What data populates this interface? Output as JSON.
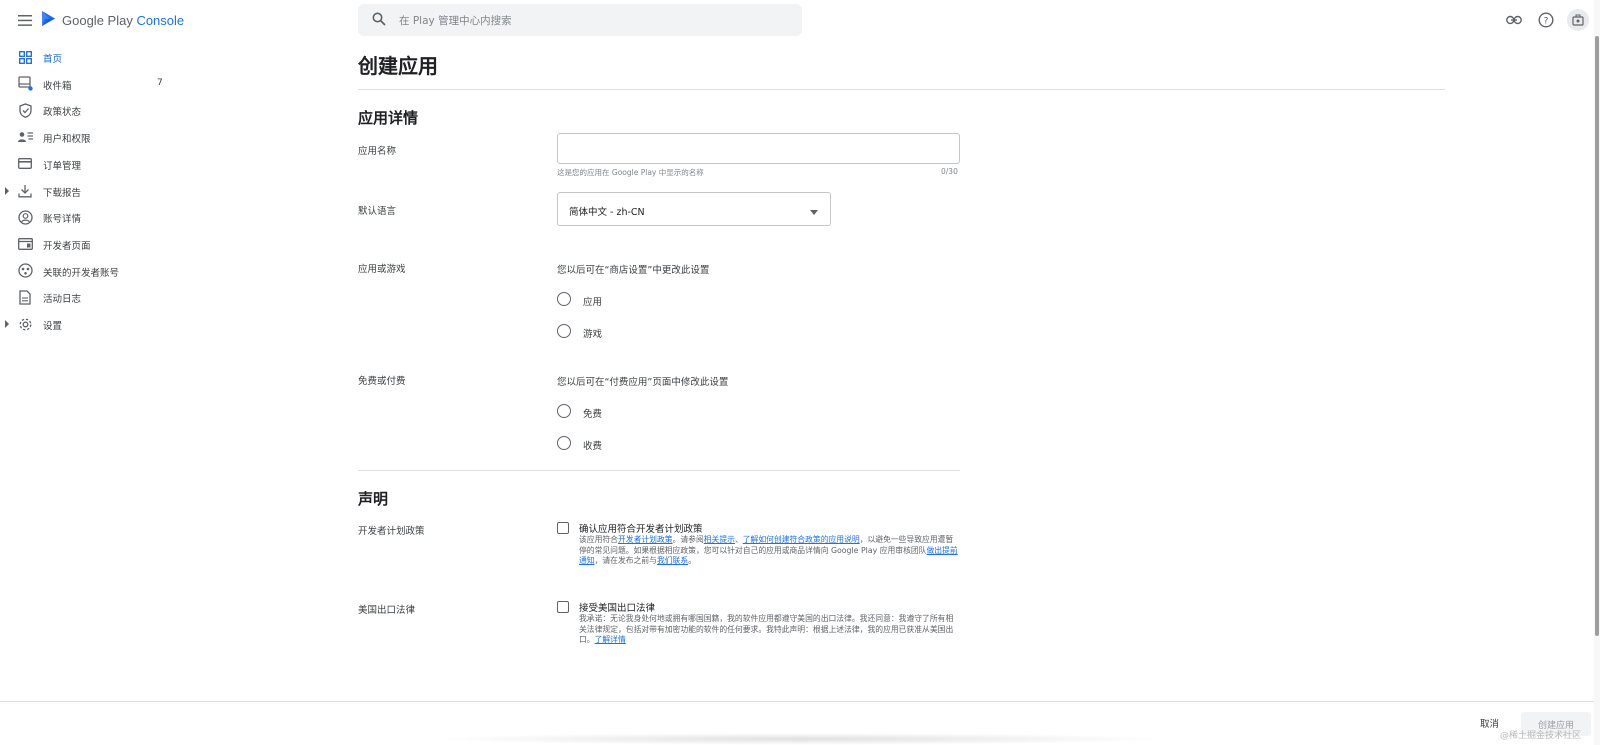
{
  "app": {
    "brand_prefix": "Google Play ",
    "brand_suffix": "Console",
    "brand_color": "#1a73e8"
  },
  "search": {
    "placeholder": "在 Play 管理中心内搜索"
  },
  "sidebar": {
    "items": [
      {
        "label": "首页",
        "icon": "dashboard-icon",
        "active": true
      },
      {
        "label": "收件箱",
        "icon": "inbox-icon",
        "count": "7"
      },
      {
        "label": "政策状态",
        "icon": "shield-icon"
      },
      {
        "label": "用户和权限",
        "icon": "users-icon"
      },
      {
        "label": "订单管理",
        "icon": "credit-card-icon"
      },
      {
        "label": "下载报告",
        "icon": "download-icon",
        "expandable": true
      },
      {
        "label": "账号详情",
        "icon": "account-icon"
      },
      {
        "label": "开发者页面",
        "icon": "web-page-icon"
      },
      {
        "label": "关联的开发者账号",
        "icon": "linked-accounts-icon"
      },
      {
        "label": "活动日志",
        "icon": "document-icon"
      },
      {
        "label": "设置",
        "icon": "gear-icon",
        "expandable": true
      }
    ]
  },
  "main": {
    "title": "创建应用",
    "details": {
      "title": "应用详情",
      "app_name": {
        "label": "应用名称",
        "value": "",
        "helper": "这是您的应用在 Google Play 中显示的名称",
        "counter": "0/30"
      },
      "language": {
        "label": "默认语言",
        "selected": "简体中文 - zh-CN"
      },
      "app_or_game": {
        "label": "应用或游戏",
        "hint": "您以后可在“商店设置”中更改此设置",
        "options": [
          "应用",
          "游戏"
        ]
      },
      "free_or_paid": {
        "label": "免费或付费",
        "hint": "您以后可在“付费应用”页面中修改此设置",
        "options": [
          "免费",
          "收费"
        ]
      }
    },
    "declarations": {
      "title": "声明",
      "policy": {
        "label": "开发者计划政策",
        "checkbox_title": "确认应用符合开发者计划政策",
        "text_1": "该应用符合",
        "link_1": "开发者计划政策",
        "text_2": "。请参阅",
        "link_2": "相关提示",
        "text_3": "、",
        "link_3": "了解如何创建符合政策的应用说明",
        "text_4": "，以避免一些导致应用遭暂停的常见问题。如果根据相应政策，您可以针对自己的应用或商品详情向 Google Play 应用审核团队",
        "link_4": "做出提前通知",
        "text_5": "，请在发布之前与",
        "link_5": "我们联系",
        "text_6": "。"
      },
      "export": {
        "label": "美国出口法律",
        "checkbox_title": "接受美国出口法律",
        "text_1": "我承诺：无论我身处何地或拥有哪国国籍，我的软件应用都遵守美国的出口法律。我还同意：我遵守了所有相关法律规定，包括对带有加密功能的软件的任何要求。我特此声明：根据上述法律，我的应用已获准从美国出口。",
        "link_1": "了解详情"
      }
    }
  },
  "footer": {
    "cancel_label": "取消",
    "create_label": "创建应用",
    "watermark": "@稀土掘金技术社区"
  }
}
